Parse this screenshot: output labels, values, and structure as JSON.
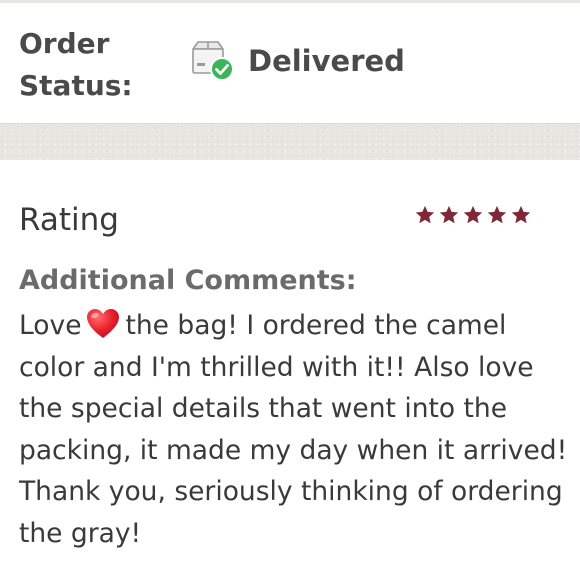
{
  "order": {
    "status_label": "Order Status:",
    "status_value": "Delivered",
    "status_icon": "package-delivered-icon",
    "status_icon_check_color": "#3cb55a"
  },
  "review": {
    "rating_label": "Rating",
    "rating_value": 5,
    "rating_max": 5,
    "star_color": "#7e2739",
    "comments_heading": "Additional Comments:",
    "comment_before_emoji": "Love",
    "emoji": "heart-emoji",
    "comment_after_emoji": "the bag! I ordered the camel color and I'm thrilled with it!! Also love the special details that went into the packing, it made my day when it arrived! Thank you, seriously thinking of ordering the gray!"
  },
  "colors": {
    "divider_band": "#e8e6e1",
    "text_primary": "#3a3a3a",
    "text_secondary": "#6b6b6b"
  }
}
